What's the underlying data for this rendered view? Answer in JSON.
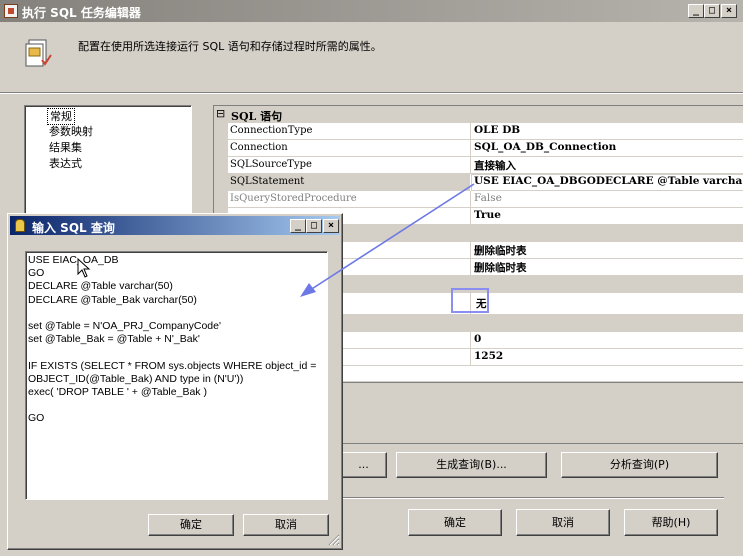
{
  "window": {
    "title": "执行 SQL 任务编辑器"
  },
  "caption_buttons": {
    "minimize": "_",
    "maximize": "□",
    "close": "×"
  },
  "header": {
    "description": "配置在使用所选连接运行 SQL 语句和存储过程时所需的属性。"
  },
  "tree": {
    "items": [
      "常规",
      "参数映射",
      "结果集",
      "表达式"
    ],
    "selected": "常规"
  },
  "grid": {
    "section": "SQL 语句",
    "expander": "⊟",
    "rows": [
      {
        "key": "ConnectionType",
        "value": "OLE DB"
      },
      {
        "key": "Connection",
        "value": "SQL_OA_DB_Connection"
      },
      {
        "key": "SQLSourceType",
        "value": "直接输入"
      },
      {
        "key": "SQLStatement",
        "value": "USE EIAC_OA_DBGODECLARE @Table varcha"
      },
      {
        "key": "IsQueryStoredProcedure",
        "value": "False"
      },
      {
        "key": "",
        "value": "True"
      },
      {
        "key": "",
        "value": ""
      },
      {
        "key": "",
        "value": "删除临时表"
      },
      {
        "key": "",
        "value": "删除临时表"
      },
      {
        "key": "",
        "value": ""
      },
      {
        "key": "",
        "value": "无"
      },
      {
        "key": "",
        "value": ""
      },
      {
        "key": "",
        "value": "0"
      },
      {
        "key": "",
        "value": "1252"
      }
    ]
  },
  "main_buttons": {
    "browse": "...",
    "build_query": "生成查询(B)...",
    "parse_query": "分析查询(P)",
    "ok": "确定",
    "cancel": "取消",
    "help": "帮助(H)"
  },
  "dialog": {
    "title": "输入 SQL 查询",
    "sql": "USE EIAC_OA_DB\nGO\nDECLARE @Table varchar(50)\nDECLARE @Table_Bak varchar(50)\n\nset @Table = N'OA_PRJ_CompanyCode'\nset @Table_Bak = @Table + N'_Bak'\n\nIF EXISTS (SELECT * FROM sys.objects WHERE object_id =\nOBJECT_ID(@Table_Bak) AND type in (N'U'))\nexec( 'DROP TABLE ' + @Table_Bak )\n\nGO",
    "ok": "确定",
    "cancel": "取消"
  },
  "colors": {
    "face": "#d4d0c8",
    "annotation": "#6b78e6",
    "active_title": "#0a246a"
  }
}
